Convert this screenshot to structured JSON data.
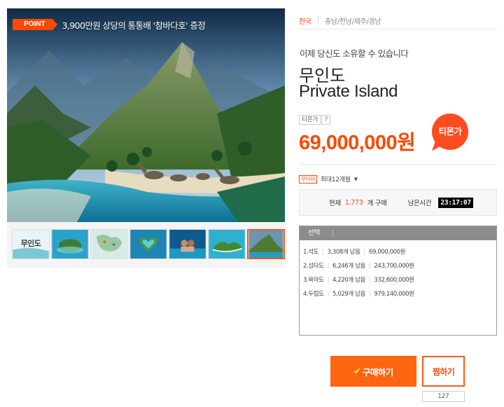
{
  "gallery": {
    "point_tag": "POINT",
    "point_text": "3,900만원 상당의 통통배 '참바다호' 증정",
    "thumbnails": [
      {
        "name": "thumb-title",
        "label": "무인도",
        "active": false
      },
      {
        "name": "thumb-island-1",
        "label": "",
        "active": false
      },
      {
        "name": "thumb-map",
        "label": "",
        "active": false
      },
      {
        "name": "thumb-heart-island",
        "label": "",
        "active": false
      },
      {
        "name": "thumb-couple",
        "label": "",
        "active": false
      },
      {
        "name": "thumb-island-2",
        "label": "",
        "active": false
      },
      {
        "name": "thumb-mountain",
        "label": "",
        "active": true
      }
    ]
  },
  "product": {
    "regions": [
      "전국",
      "충남/전남/제주/경남"
    ],
    "subtitle": "이제 당신도 소유할 수 있습니다",
    "title_ko": "무인도",
    "title_en": "Private Island",
    "price_label": "티몬가",
    "price_help": "?",
    "price": "69,000,000원",
    "price_bubble": "티몬가",
    "limit_tag": "무이자",
    "limit_text": "최대12개월",
    "limit_caret": "▼"
  },
  "status": {
    "now_label": "현재",
    "count": "1,773",
    "count_suffix": "개 구매",
    "remain_label": "남은시간",
    "timer": "23:17:07"
  },
  "options": {
    "header": "선택",
    "header_sep": "|",
    "items": [
      {
        "name": "1.석도",
        "stock": "3,308개 남음",
        "price": "69,000,000원"
      },
      {
        "name": "2.섬타도",
        "stock": "6,246개 남음",
        "price": "243,700,000원"
      },
      {
        "name": "3.육아도",
        "stock": "4,220개 남음",
        "price": "332,600,000원"
      },
      {
        "name": "4.두럽도",
        "stock": "5,029개 남음",
        "price": "979,140,000원"
      }
    ]
  },
  "actions": {
    "buy_check": "✔",
    "buy_label": "구매하기",
    "wish_label": "찜하기",
    "wish_count": "127"
  },
  "colors": {
    "accent": "#ff4800",
    "buy": "#ff6410",
    "option_header": "#8c8c8c"
  }
}
